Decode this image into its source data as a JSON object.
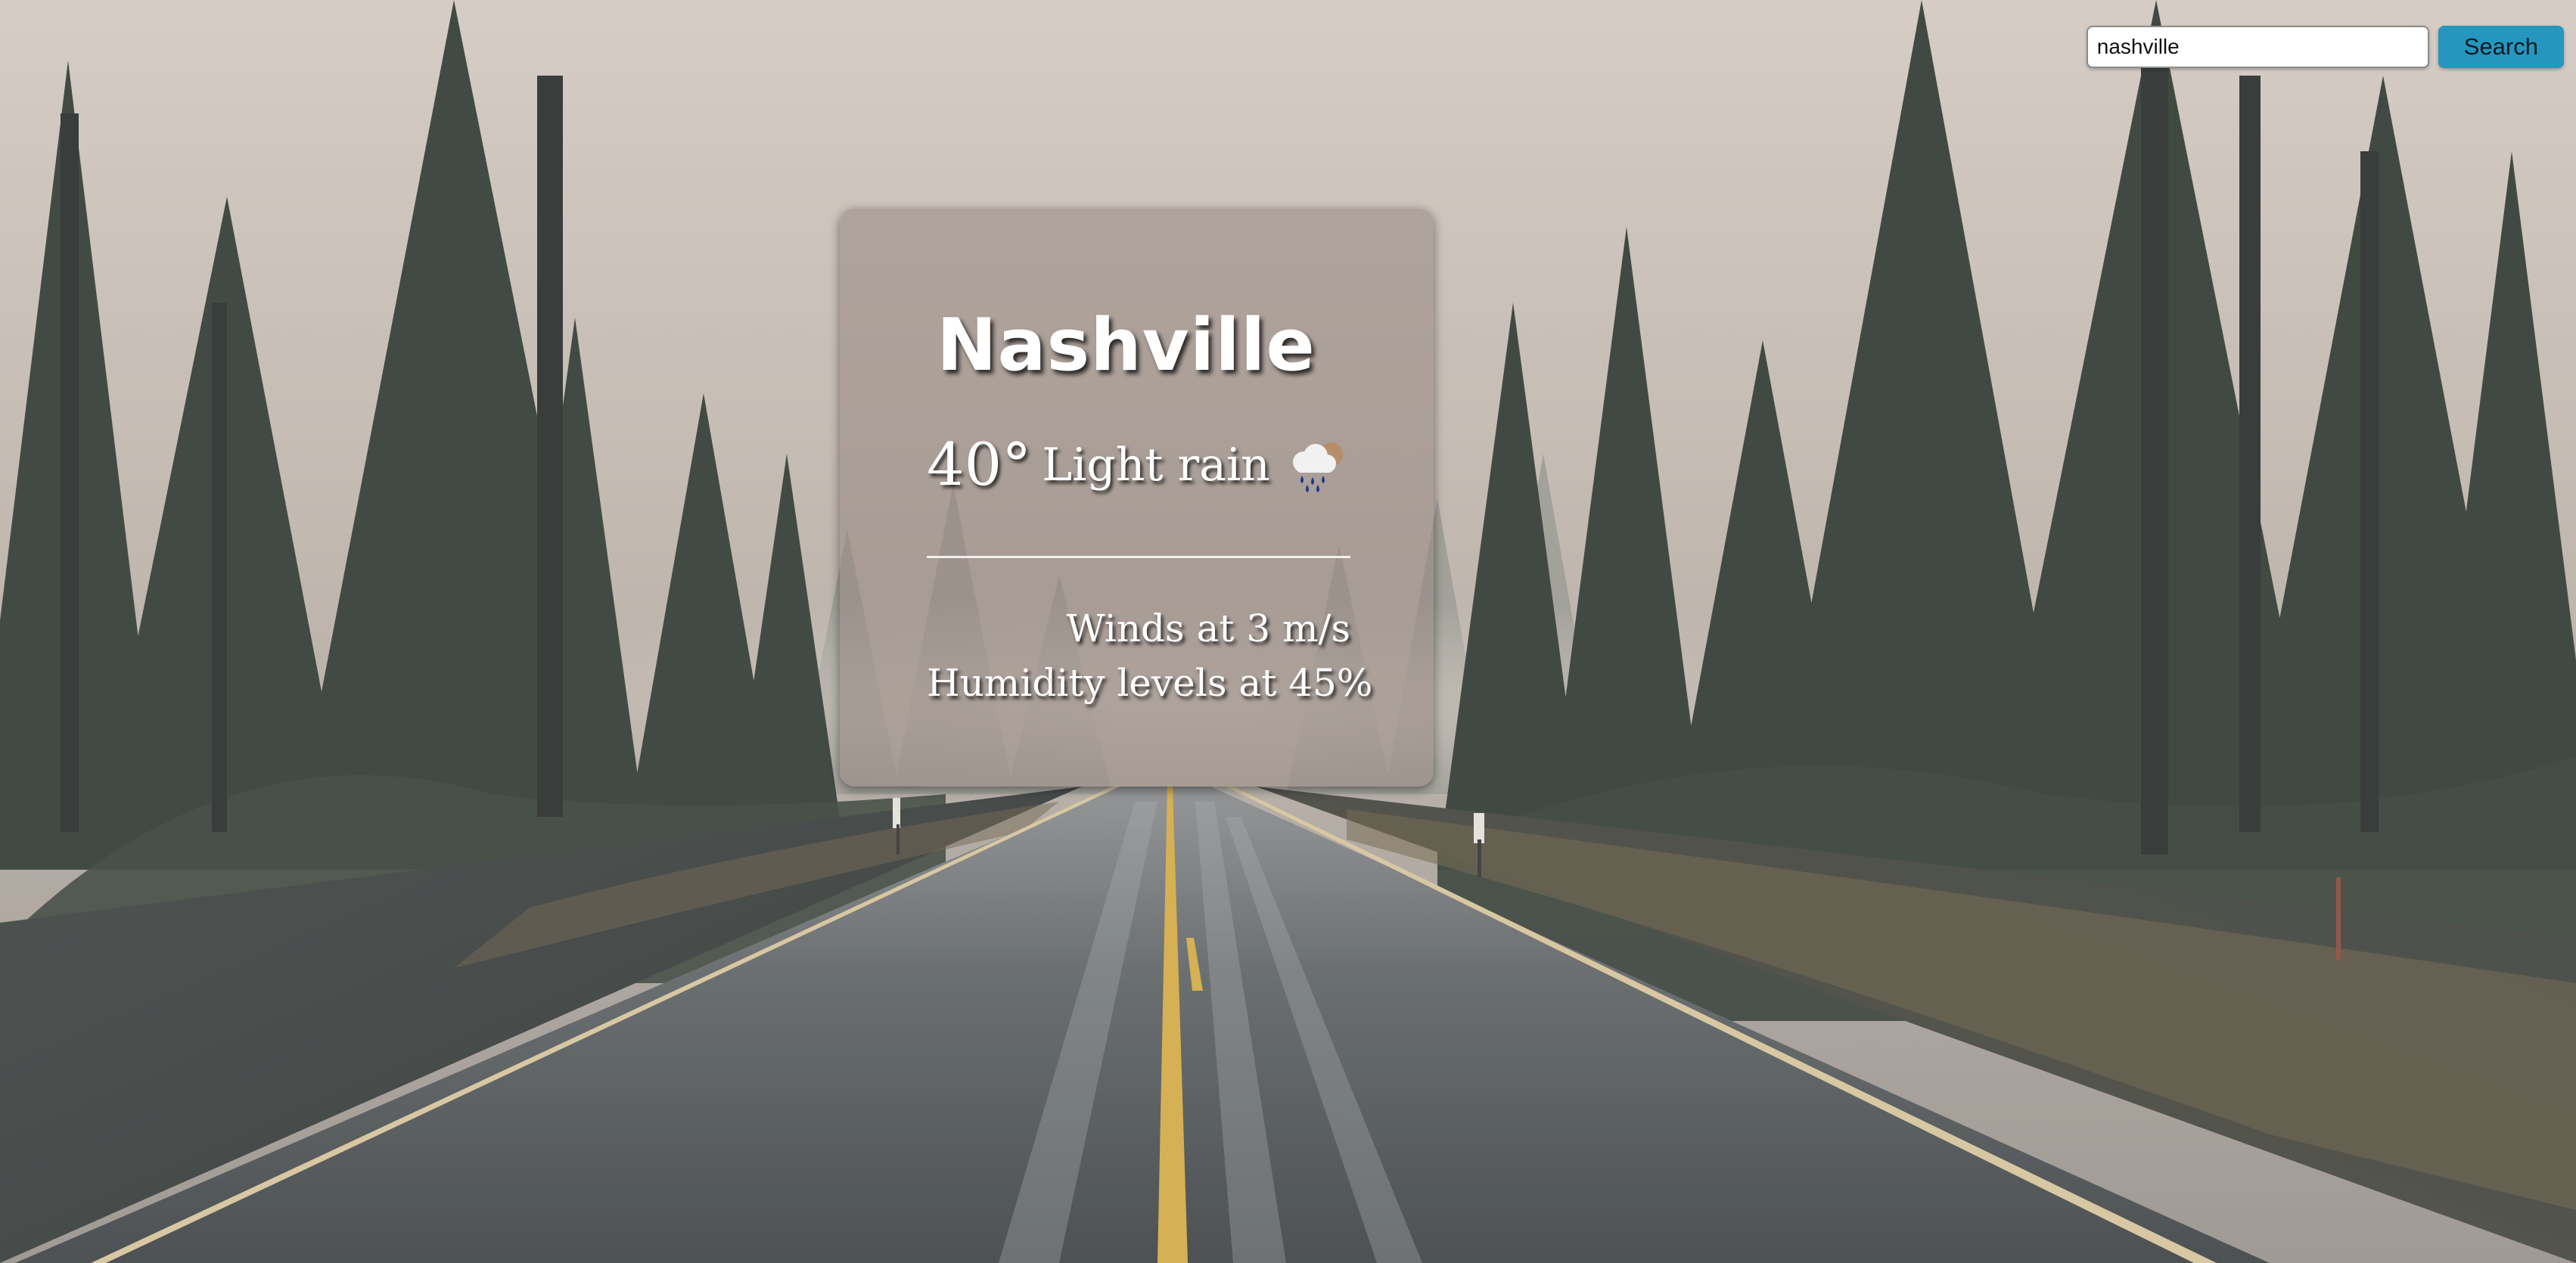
{
  "search": {
    "value": "nashville",
    "button_label": "Search"
  },
  "weather": {
    "city": "Nashville",
    "temperature": "40°",
    "description": "Light rain",
    "icon": "rain-cloud-icon",
    "wind": "Winds at 3 m/s",
    "humidity": "Humidity levels at 45%"
  },
  "colors": {
    "search_button": "#2596be",
    "card_background": "rgba(150,135,130,0.55)",
    "text": "#ffffff"
  }
}
